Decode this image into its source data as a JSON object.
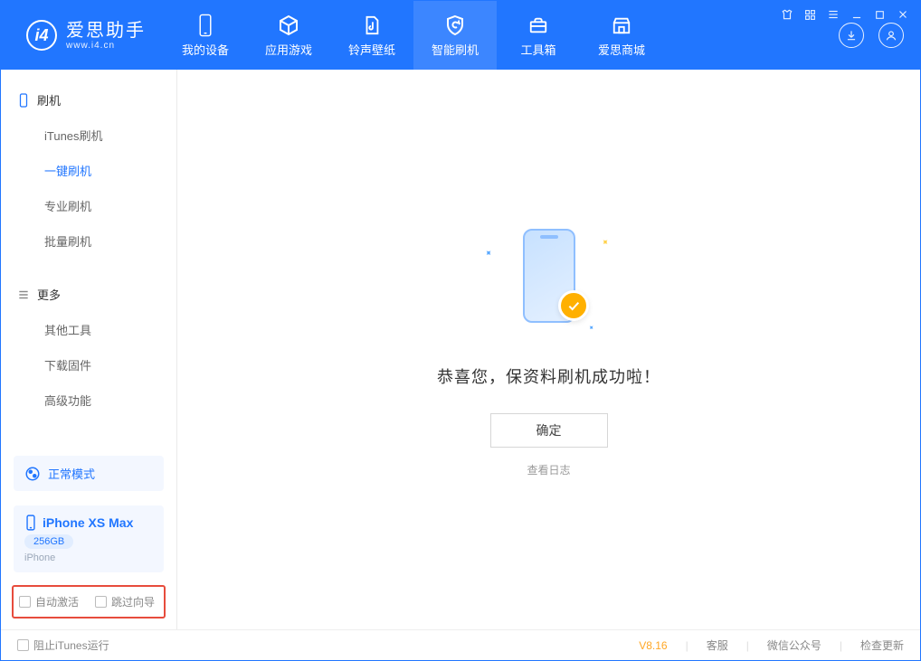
{
  "logo": {
    "main": "爱思助手",
    "sub": "www.i4.cn"
  },
  "nav": {
    "device": "我的设备",
    "apps": "应用游戏",
    "ring": "铃声壁纸",
    "flash": "智能刷机",
    "toolbox": "工具箱",
    "store": "爱思商城"
  },
  "sidebar": {
    "flash_head": "刷机",
    "itunes_flash": "iTunes刷机",
    "one_key_flash": "一键刷机",
    "pro_flash": "专业刷机",
    "batch_flash": "批量刷机",
    "more_head": "更多",
    "other_tools": "其他工具",
    "download_fw": "下载固件",
    "advanced": "高级功能"
  },
  "mode": {
    "label": "正常模式"
  },
  "device": {
    "name": "iPhone XS Max",
    "capacity": "256GB",
    "type": "iPhone"
  },
  "checks": {
    "auto_activate": "自动激活",
    "skip_guide": "跳过向导"
  },
  "main": {
    "success": "恭喜您，保资料刷机成功啦！",
    "ok": "确定",
    "view_log": "查看日志"
  },
  "status": {
    "stop_itunes": "阻止iTunes运行",
    "version": "V8.16",
    "service": "客服",
    "wechat": "微信公众号",
    "update": "检查更新"
  }
}
